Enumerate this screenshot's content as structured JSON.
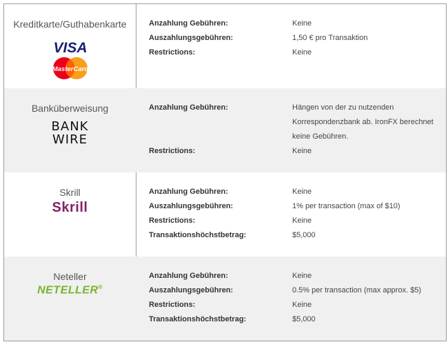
{
  "rows": [
    {
      "method": "Kreditkarte/Guthabenkarte",
      "logos": [
        "visa-logo",
        "mastercard-logo"
      ],
      "logo_text": {
        "visa": "VISA",
        "mastercard": "MasterCard"
      },
      "lines": [
        {
          "label": "Anzahlung Gebühren:",
          "value": "Keine"
        },
        {
          "label": "Auszahlungsgebühren:",
          "value": "1,50 € pro Transaktion"
        },
        {
          "label": "Restrictions:",
          "value": "Keine"
        }
      ]
    },
    {
      "method": "Banküberweisung",
      "logo_text": {
        "line1": "BANK",
        "line2": "WIRE"
      },
      "lines": [
        {
          "label": "Anzahlung Gebühren:",
          "value": "Hängen von der zu nutzenden Korrespondenzbank ab. IronFX berechnet keine Gebühren."
        },
        {
          "label": "Restrictions:",
          "value": "Keine"
        }
      ]
    },
    {
      "method": "Skrill",
      "logo_text": {
        "name": "Skrill"
      },
      "lines": [
        {
          "label": "Anzahlung Gebühren:",
          "value": "Keine"
        },
        {
          "label": "Auszahlungsgebühren:",
          "value": "1% per transaction (max of $10)"
        },
        {
          "label": "Restrictions:",
          "value": "Keine"
        },
        {
          "label": "Transaktionshöchstbetrag:",
          "value": "$5,000"
        }
      ]
    },
    {
      "method": "Neteller",
      "logo_text": {
        "name": "NETELLER",
        "mark": "®"
      },
      "lines": [
        {
          "label": "Anzahlung Gebühren:",
          "value": "Keine"
        },
        {
          "label": "Auszahlungsgebühren:",
          "value": "0.5% per transaction (max approx. $5)"
        },
        {
          "label": "Restrictions:",
          "value": "Keine"
        },
        {
          "label": "Transaktionshöchstbetrag:",
          "value": "$5,000"
        }
      ]
    }
  ],
  "colors": {
    "row_alt_bg": "#f0f0f0",
    "border": "#9a9a9a",
    "visa_blue": "#1a1f71",
    "mastercard_red": "#eb001b",
    "mastercard_yellow": "#f79e1b",
    "skrill_purple": "#862165",
    "neteller_green": "#79b42a"
  }
}
